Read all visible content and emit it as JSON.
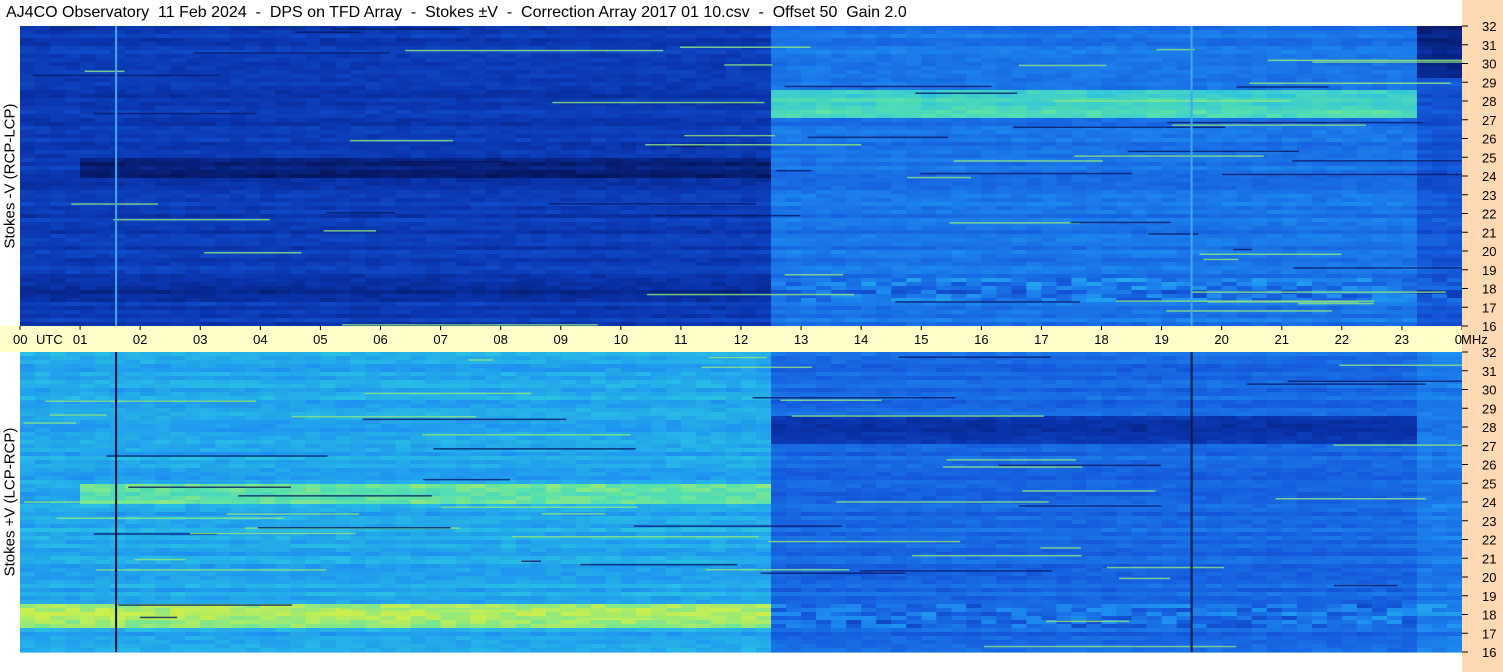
{
  "header": {
    "title": "AJ4CO Observatory  11 Feb 2024  -  DPS on TFD Array  -  Stokes ±V  -  Correction Array 2017 01 10.csv  -  Offset 50  Gain 2.0"
  },
  "chart_data": {
    "type": "heatmap",
    "title": "AJ4CO Observatory  11 Feb 2024  -  DPS on TFD Array  -  Stokes ±V  -  Correction Array 2017 01 10.csv  -  Offset 50  Gain 2.0",
    "x_axis": {
      "ticks": [
        "00",
        "01",
        "02",
        "03",
        "04",
        "05",
        "06",
        "07",
        "08",
        "09",
        "10",
        "11",
        "12",
        "13",
        "14",
        "15",
        "16",
        "17",
        "18",
        "19",
        "20",
        "21",
        "22",
        "23",
        "00"
      ],
      "unit_label": "UTC",
      "range_hours": [
        0,
        24
      ]
    },
    "y_axis": {
      "unit": "MHz",
      "range": [
        16,
        32
      ],
      "ticks": [
        16,
        17,
        18,
        19,
        20,
        21,
        22,
        23,
        24,
        25,
        26,
        27,
        28,
        29,
        30,
        31,
        32
      ]
    },
    "panels": [
      {
        "name": "Stokes -V (RCP-LCP)",
        "base_level_before_12_4h": 0.18,
        "base_level_after_12_4h": 0.38,
        "bright_band_mhz": [
          27,
          28.5
        ],
        "bright_band_hours": [
          12.4,
          23.2
        ],
        "dark_band_mhz": [
          24,
          25
        ],
        "dark_band_hours": [
          1,
          12.4
        ],
        "vertical_marker_hours": [
          1.6,
          19.5
        ],
        "edge_column_hours": [
          23.2,
          24
        ]
      },
      {
        "name": "Stokes +V (LCP-RCP)",
        "base_level_before_12_4h": 0.52,
        "base_level_after_12_4h": 0.34,
        "dark_band_mhz": [
          27,
          28.5
        ],
        "dark_band_hours": [
          12.4,
          23.2
        ],
        "bright_band_mhz": [
          24,
          25
        ],
        "bright_band_hours": [
          1,
          12.4
        ],
        "vertical_marker_hours": [
          1.6,
          19.5
        ],
        "edge_column_hours": [
          23.2,
          24
        ]
      }
    ],
    "colormap": "blue-cyan-yellow-red",
    "colors": {
      "axis_strip": "#ffffcc",
      "right_strip": "#ffd9b3"
    }
  }
}
